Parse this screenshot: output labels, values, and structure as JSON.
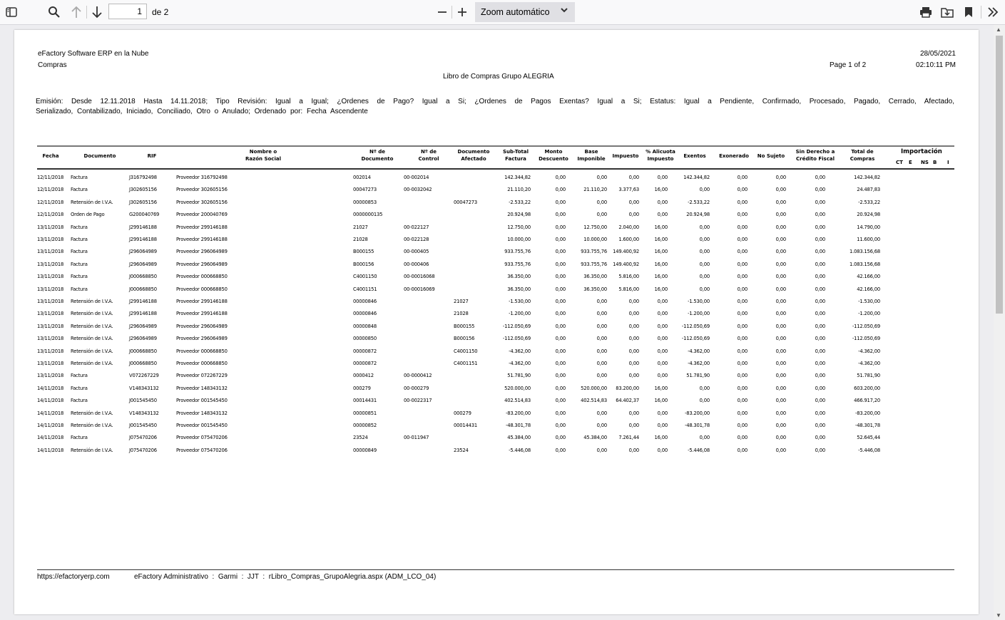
{
  "toolbar": {
    "current_page": "1",
    "page_count_label": "de 2",
    "zoom_label": "Zoom automático",
    "icons": [
      "sidebar-toggle-icon",
      "search-icon",
      "arrow-up-icon",
      "arrow-down-icon",
      "zoom-out-icon",
      "zoom-in-icon",
      "chevron-down-icon",
      "print-icon",
      "download-icon",
      "bookmark-icon",
      "double-chevron-right-icon"
    ]
  },
  "report": {
    "company": "eFactory Software ERP en la Nube",
    "module": "Compras",
    "title": "Libro de Compras Grupo ALEGRIA",
    "page_label": "Page 1 of 2",
    "date": "28/05/2021",
    "time": "02:10:11 PM",
    "filters_line1": "Emisión: Desde 12.11.2018 Hasta 14.11.2018; Tipo Revisión: Igual a Igual; ¿Ordenes de Pago? Igual a Si; ¿Ordenes de Pagos Exentas? Igual a Si; Estatus: Igual a Pendiente, Confirmado, Procesado, Pagado, Cerrado, Afectado,",
    "filters_line2": "Serializado, Contabilizado, Iniciado, Conciliado, Otro o Anulado; Ordenado por: Fecha Ascendente"
  },
  "table": {
    "headers": [
      "Fecha",
      "Documento",
      "RIF",
      "Nombre o\nRazón Social",
      "Nº de\nDocumento",
      "Nº de\nControl",
      "Documento\nAfectado",
      "Sub-Total\nFactura",
      "Monto\nDescuento",
      "Base\nImponible",
      "Impuesto",
      "% Alicuota\nImpuesto",
      "Exentos",
      "Exonerado",
      "No Sujeto",
      "Sin Derecho a\nCrédito Fiscal",
      "Total de\nCompras"
    ],
    "import_header": "Importación",
    "import_subheaders": [
      "CT",
      "E",
      "NS",
      "B",
      "I"
    ],
    "rows": [
      [
        "12/11/2018",
        "Factura",
        "J316792498",
        "Proveedor 316792498",
        "002014",
        "00-002014",
        "",
        "142.344,82",
        "0,00",
        "0,00",
        "0,00",
        "0,00",
        "142.344,82",
        "0,00",
        "0,00",
        "0,00",
        "142.344,82"
      ],
      [
        "12/11/2018",
        "Factura",
        "J302605156",
        "Proveedor 302605156",
        "00047273",
        "00-0032042",
        "",
        "21.110,20",
        "0,00",
        "21.110,20",
        "3.377,63",
        "16,00",
        "0,00",
        "0,00",
        "0,00",
        "0,00",
        "24.487,83"
      ],
      [
        "12/11/2018",
        "Retensión de I.V.A.",
        "J302605156",
        "Proveedor 302605156",
        "00000853",
        "",
        "00047273",
        "-2.533,22",
        "0,00",
        "0,00",
        "0,00",
        "0,00",
        "-2.533,22",
        "0,00",
        "0,00",
        "0,00",
        "-2.533,22"
      ],
      [
        "12/11/2018",
        "Orden de Pago",
        "G200040769",
        "Proveedor 200040769",
        "0000000135",
        "",
        "",
        "20.924,98",
        "0,00",
        "0,00",
        "0,00",
        "0,00",
        "20.924,98",
        "0,00",
        "0,00",
        "0,00",
        "20.924,98"
      ],
      [
        "13/11/2018",
        "Factura",
        "J299146188",
        "Proveedor 299146188",
        "21027",
        "00-022127",
        "",
        "12.750,00",
        "0,00",
        "12.750,00",
        "2.040,00",
        "16,00",
        "0,00",
        "0,00",
        "0,00",
        "0,00",
        "14.790,00"
      ],
      [
        "13/11/2018",
        "Factura",
        "J299146188",
        "Proveedor 299146188",
        "21028",
        "00-022128",
        "",
        "10.000,00",
        "0,00",
        "10.000,00",
        "1.600,00",
        "16,00",
        "0,00",
        "0,00",
        "0,00",
        "0,00",
        "11.600,00"
      ],
      [
        "13/11/2018",
        "Factura",
        "J296064989",
        "Proveedor 296064989",
        "B000155",
        "00-000405",
        "",
        "933.755,76",
        "0,00",
        "933.755,76",
        "149.400,92",
        "16,00",
        "0,00",
        "0,00",
        "0,00",
        "0,00",
        "1.083.156,68"
      ],
      [
        "13/11/2018",
        "Factura",
        "J296064989",
        "Proveedor 296064989",
        "B000156",
        "00-000406",
        "",
        "933.755,76",
        "0,00",
        "933.755,76",
        "149.400,92",
        "16,00",
        "0,00",
        "0,00",
        "0,00",
        "0,00",
        "1.083.156,68"
      ],
      [
        "13/11/2018",
        "Factura",
        "J000668850",
        "Proveedor 000668850",
        "C4001150",
        "00-00016068",
        "",
        "36.350,00",
        "0,00",
        "36.350,00",
        "5.816,00",
        "16,00",
        "0,00",
        "0,00",
        "0,00",
        "0,00",
        "42.166,00"
      ],
      [
        "13/11/2018",
        "Factura",
        "J000668850",
        "Proveedor 000668850",
        "C4001151",
        "00-00016069",
        "",
        "36.350,00",
        "0,00",
        "36.350,00",
        "5.816,00",
        "16,00",
        "0,00",
        "0,00",
        "0,00",
        "0,00",
        "42.166,00"
      ],
      [
        "13/11/2018",
        "Retensión de I.V.A.",
        "J299146188",
        "Proveedor 299146188",
        "00000846",
        "",
        "21027",
        "-1.530,00",
        "0,00",
        "0,00",
        "0,00",
        "0,00",
        "-1.530,00",
        "0,00",
        "0,00",
        "0,00",
        "-1.530,00"
      ],
      [
        "13/11/2018",
        "Retensión de I.V.A.",
        "J299146188",
        "Proveedor 299146188",
        "00000846",
        "",
        "21028",
        "-1.200,00",
        "0,00",
        "0,00",
        "0,00",
        "0,00",
        "-1.200,00",
        "0,00",
        "0,00",
        "0,00",
        "-1.200,00"
      ],
      [
        "13/11/2018",
        "Retensión de I.V.A.",
        "J296064989",
        "Proveedor 296064989",
        "00000848",
        "",
        "B000155",
        "-112.050,69",
        "0,00",
        "0,00",
        "0,00",
        "0,00",
        "-112.050,69",
        "0,00",
        "0,00",
        "0,00",
        "-112.050,69"
      ],
      [
        "13/11/2018",
        "Retensión de I.V.A.",
        "J296064989",
        "Proveedor 296064989",
        "00000850",
        "",
        "B000156",
        "-112.050,69",
        "0,00",
        "0,00",
        "0,00",
        "0,00",
        "-112.050,69",
        "0,00",
        "0,00",
        "0,00",
        "-112.050,69"
      ],
      [
        "13/11/2018",
        "Retensión de I.V.A.",
        "J000668850",
        "Proveedor 000668850",
        "00000872",
        "",
        "C4001150",
        "-4.362,00",
        "0,00",
        "0,00",
        "0,00",
        "0,00",
        "-4.362,00",
        "0,00",
        "0,00",
        "0,00",
        "-4.362,00"
      ],
      [
        "13/11/2018",
        "Retensión de I.V.A.",
        "J000668850",
        "Proveedor 000668850",
        "00000872",
        "",
        "C4001151",
        "-4.362,00",
        "0,00",
        "0,00",
        "0,00",
        "0,00",
        "-4.362,00",
        "0,00",
        "0,00",
        "0,00",
        "-4.362,00"
      ],
      [
        "13/11/2018",
        "Factura",
        "V072267229",
        "Proveedor 072267229",
        "0000412",
        "00-0000412",
        "",
        "51.781,90",
        "0,00",
        "0,00",
        "0,00",
        "0,00",
        "51.781,90",
        "0,00",
        "0,00",
        "0,00",
        "51.781,90"
      ],
      [
        "14/11/2018",
        "Factura",
        "V148343132",
        "Proveedor 148343132",
        "000279",
        "00-000279",
        "",
        "520.000,00",
        "0,00",
        "520.000,00",
        "83.200,00",
        "16,00",
        "0,00",
        "0,00",
        "0,00",
        "0,00",
        "603.200,00"
      ],
      [
        "14/11/2018",
        "Factura",
        "J001545450",
        "Proveedor 001545450",
        "00014431",
        "00-0022317",
        "",
        "402.514,83",
        "0,00",
        "402.514,83",
        "64.402,37",
        "16,00",
        "0,00",
        "0,00",
        "0,00",
        "0,00",
        "466.917,20"
      ],
      [
        "14/11/2018",
        "Retensión de I.V.A.",
        "V148343132",
        "Proveedor 148343132",
        "00000851",
        "",
        "000279",
        "-83.200,00",
        "0,00",
        "0,00",
        "0,00",
        "0,00",
        "-83.200,00",
        "0,00",
        "0,00",
        "0,00",
        "-83.200,00"
      ],
      [
        "14/11/2018",
        "Retensión de I.V.A.",
        "J001545450",
        "Proveedor 001545450",
        "00000852",
        "",
        "00014431",
        "-48.301,78",
        "0,00",
        "0,00",
        "0,00",
        "0,00",
        "-48.301,78",
        "0,00",
        "0,00",
        "0,00",
        "-48.301,78"
      ],
      [
        "14/11/2018",
        "Factura",
        "J075470206",
        "Proveedor 075470206",
        "23524",
        "00-011947",
        "",
        "45.384,00",
        "0,00",
        "45.384,00",
        "7.261,44",
        "16,00",
        "0,00",
        "0,00",
        "0,00",
        "0,00",
        "52.645,44"
      ],
      [
        "14/11/2018",
        "Retensión de I.V.A.",
        "J075470206",
        "Proveedor 075470206",
        "00000849",
        "",
        "23524",
        "-5.446,08",
        "0,00",
        "0,00",
        "0,00",
        "0,00",
        "-5.446,08",
        "0,00",
        "0,00",
        "0,00",
        "-5.446,08"
      ]
    ]
  },
  "footer": {
    "url": "https://efactoryerp.com",
    "info": "eFactory Administrativo  :  Garmi  :  JJT  :  rLibro_Compras_GrupoAlegria.aspx (ADM_LCO_04)"
  }
}
